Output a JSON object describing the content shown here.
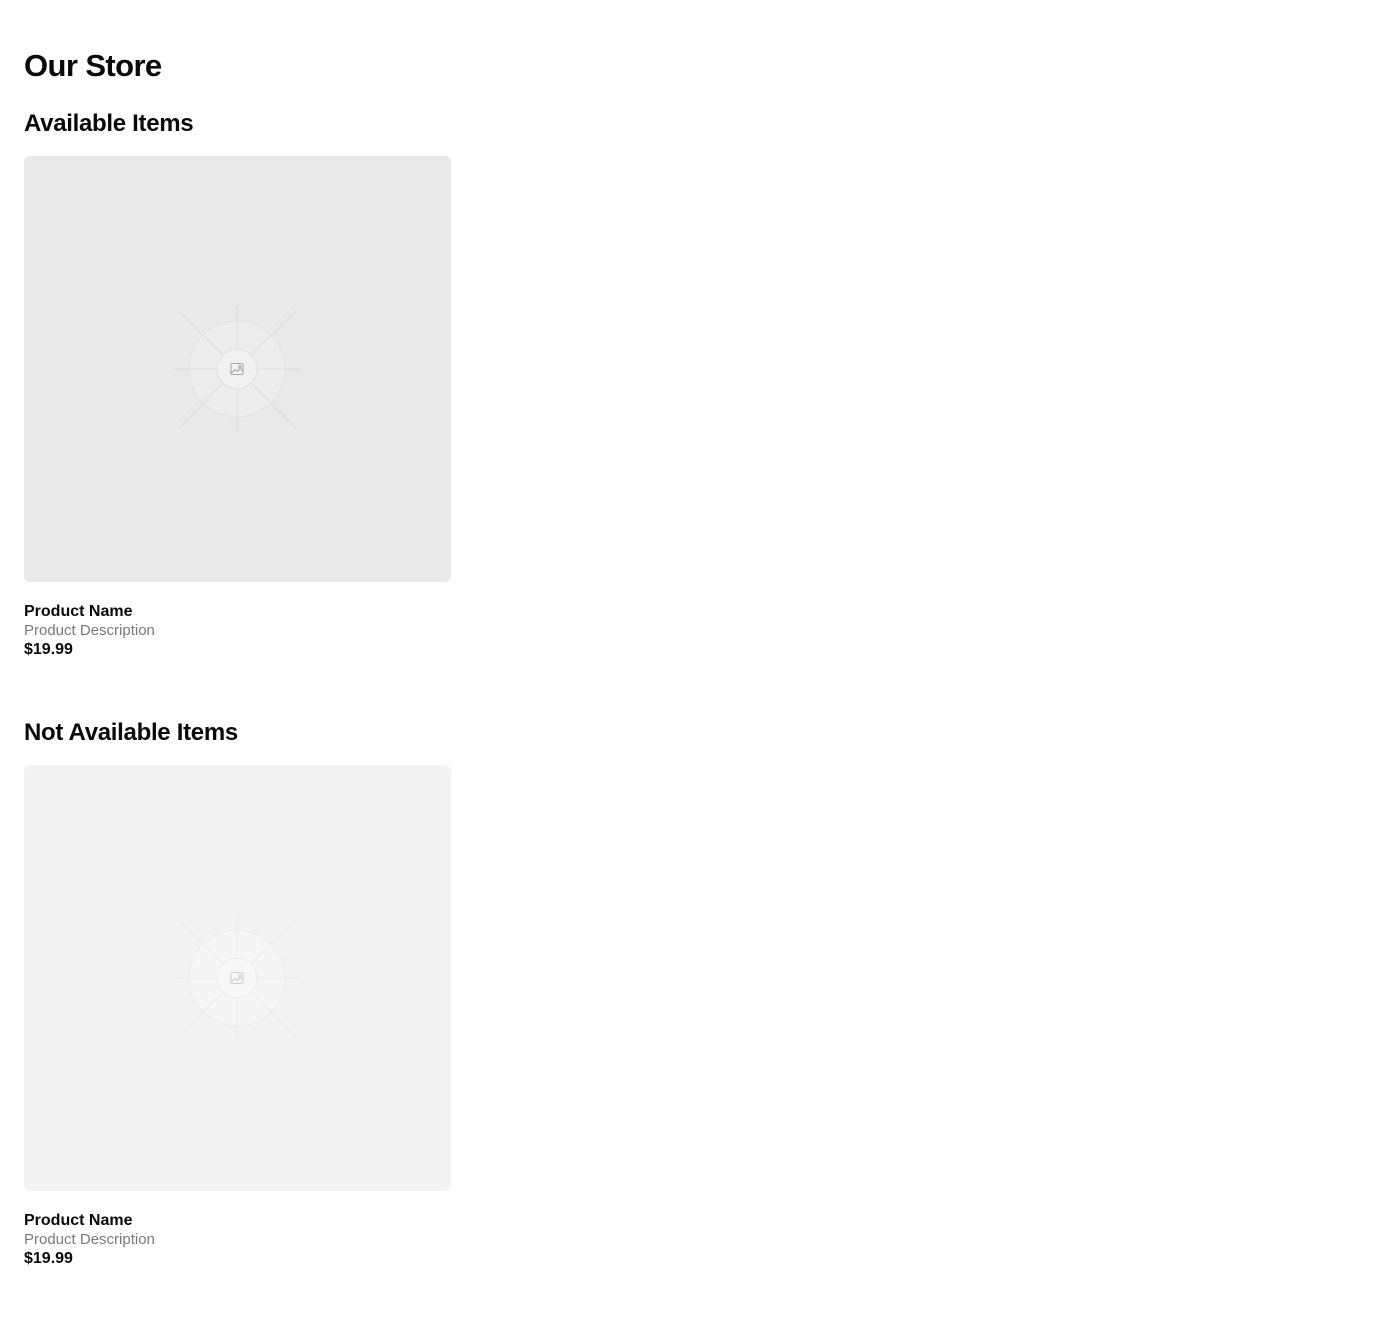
{
  "page": {
    "title": "Our Store"
  },
  "sections": {
    "available": {
      "heading": "Available Items",
      "product": {
        "name": "Product Name",
        "description": "Product Description",
        "price": "$19.99",
        "image_icon": "image-placeholder-icon"
      }
    },
    "unavailable": {
      "heading": "Not Available Items",
      "product": {
        "name": "Product Name",
        "description": "Product Description",
        "price": "$19.99",
        "image_icon": "image-placeholder-icon"
      }
    }
  },
  "colors": {
    "available_image_bg": "#e9e9e9",
    "unavailable_image_bg": "#f3f3f3",
    "description_text": "#7a7a7a",
    "primary_text": "#0a0a0a"
  }
}
